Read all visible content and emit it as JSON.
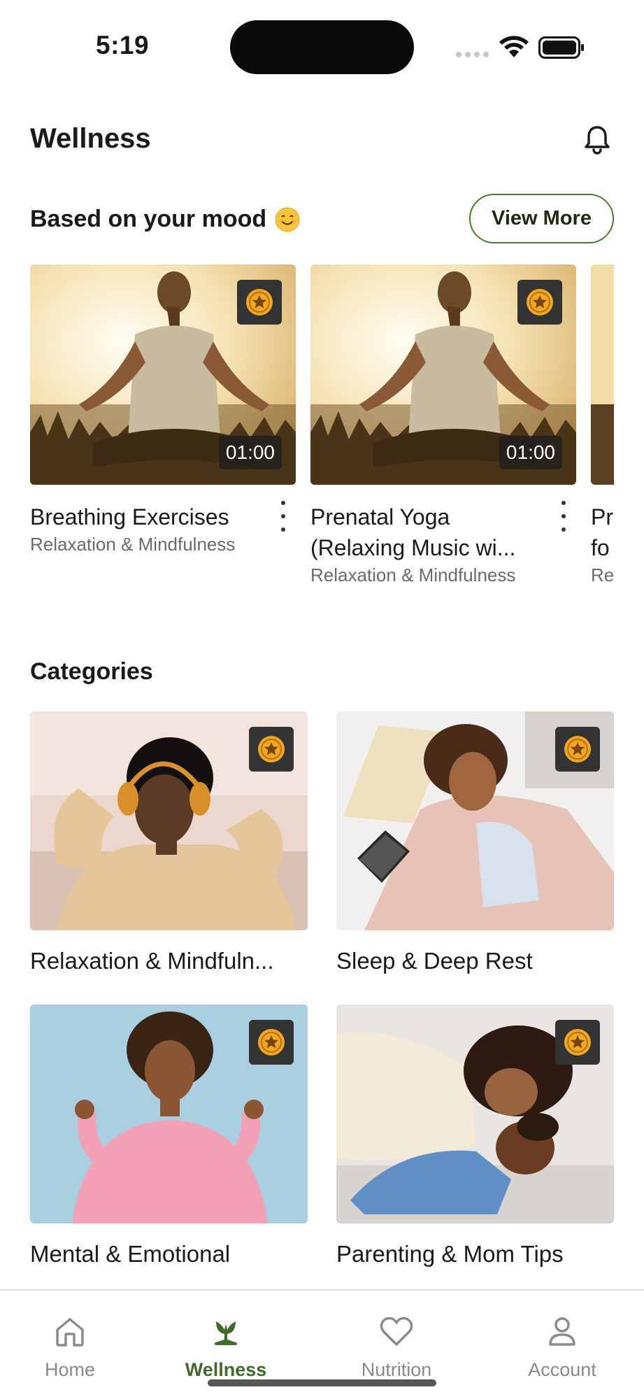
{
  "status_bar": {
    "time": "5:19"
  },
  "header": {
    "title": "Wellness"
  },
  "mood_section": {
    "title": "Based on your mood",
    "view_more_label": "View More",
    "cards": [
      {
        "title": "Breathing Exercises",
        "subtitle": "Relaxation & Mindfulness",
        "duration": "01:00"
      },
      {
        "title": "Prenatal Yoga (Relaxing Music wi...",
        "subtitle": "Relaxation & Mindfulness",
        "duration": "01:00"
      },
      {
        "title": "Pr fo",
        "subtitle": "Re"
      }
    ]
  },
  "categories": {
    "title": "Categories",
    "items": [
      {
        "label": "Relaxation & Mindfuln..."
      },
      {
        "label": "Sleep & Deep Rest"
      },
      {
        "label": "Mental & Emotional"
      },
      {
        "label": "Parenting & Mom Tips"
      }
    ]
  },
  "bottom_nav": {
    "items": [
      {
        "label": "Home",
        "icon": "home-icon"
      },
      {
        "label": "Wellness",
        "icon": "wellness-icon",
        "active": true
      },
      {
        "label": "Nutrition",
        "icon": "heart-icon"
      },
      {
        "label": "Account",
        "icon": "account-icon"
      }
    ]
  },
  "colors": {
    "accent": "#3f6a2a",
    "badge_bg": "#333333",
    "coin": "#f0a81e"
  }
}
